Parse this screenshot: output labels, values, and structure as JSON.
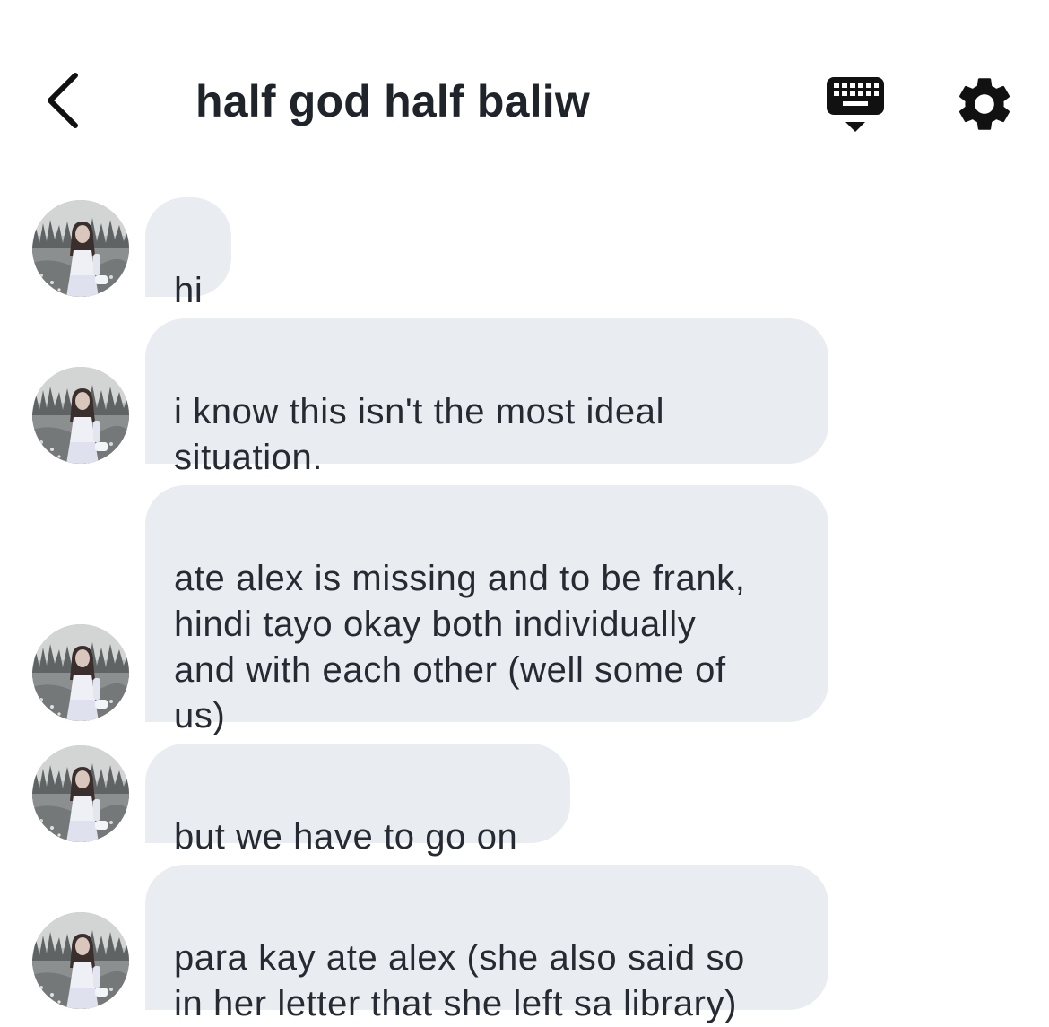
{
  "header": {
    "title": "half god half baliw",
    "back_icon": "chevron-left-icon",
    "keyboard_icon": "keyboard-icon",
    "settings_icon": "gear-icon"
  },
  "messages": [
    {
      "text": "hi"
    },
    {
      "text": "i know this isn't the most ideal\nsituation."
    },
    {
      "text": "ate alex is missing and to be frank,\nhindi tayo okay both individually\nand with each other (well some of\nus)"
    },
    {
      "text": "but we have to go on"
    },
    {
      "text": "para kay ate alex (she also said so\nin her letter that she left sa library)"
    }
  ],
  "colors": {
    "bubble_bg": "#e9ecf0",
    "text": "#262b33",
    "icon": "#111111"
  }
}
